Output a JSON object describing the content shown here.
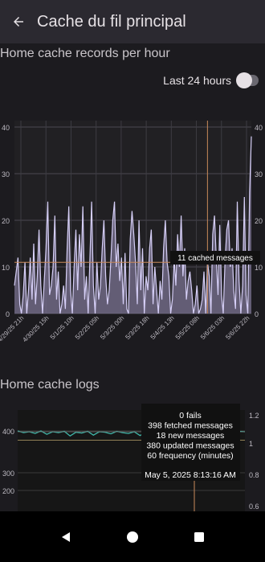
{
  "appbar": {
    "title": "Cache du fil principal"
  },
  "records": {
    "heading": "Home cache records per hour",
    "toggle_label": "Last 24 hours",
    "toggle_on": false,
    "tooltip": "11 cached messages"
  },
  "logs": {
    "heading": "Home cache logs",
    "tooltip_lines": [
      "0 fails",
      "398 fetched messages",
      "18 new messages",
      "380 updated messages",
      "60 frequency (minutes)"
    ],
    "tooltip_date": "May 5, 2025 8:13:16 AM"
  },
  "chart_data": [
    {
      "type": "area",
      "ylim": [
        0,
        40
      ],
      "y_ticks": [
        0,
        10,
        20,
        30,
        40
      ],
      "x_tick_labels": [
        "4/29/25 21h",
        "4/30/25 15h",
        "5/1/25 10h",
        "5/2/25 05h",
        "5/3/25 00h",
        "5/3/25 18h",
        "5/4/25 13h",
        "5/5/25 08h",
        "5/6/25 03h",
        "5/6/25 22h"
      ],
      "highlight_index": 110,
      "highlight_value": 11,
      "values": [
        6,
        9,
        12,
        2,
        0,
        4,
        11,
        0,
        5,
        12,
        3,
        15,
        2,
        8,
        18,
        6,
        0,
        7,
        14,
        24,
        4,
        6,
        10,
        21,
        3,
        9,
        0,
        2,
        6,
        1,
        14,
        23,
        5,
        0,
        10,
        18,
        5,
        17,
        10,
        23,
        3,
        8,
        0,
        12,
        24,
        6,
        0,
        11,
        3,
        6,
        14,
        20,
        8,
        2,
        5,
        12,
        20,
        24,
        10,
        15,
        7,
        12,
        2,
        13,
        1,
        0,
        16,
        22,
        17,
        11,
        2,
        20,
        5,
        14,
        0,
        8,
        5,
        14,
        18,
        2,
        10,
        5,
        0,
        7,
        3,
        14,
        20,
        11,
        8,
        0,
        3,
        12,
        6,
        17,
        10,
        21,
        8,
        14,
        3,
        7,
        9,
        5,
        0,
        2,
        6,
        0,
        1,
        3,
        9,
        0,
        11,
        8,
        0,
        17,
        21,
        12,
        4,
        19,
        4,
        0,
        11,
        18,
        20,
        10,
        14,
        5,
        1,
        24,
        7,
        0,
        6,
        25,
        4,
        0,
        26,
        38
      ]
    },
    {
      "type": "line",
      "y_ticks_left": [
        200,
        300,
        400
      ],
      "y_ticks_right": [
        0.6,
        0.8,
        1.0,
        1.2
      ],
      "series": [
        {
          "values": [
            400,
            396,
            398,
            394,
            400,
            392,
            398,
            396,
            399,
            388,
            397,
            395,
            399,
            390,
            398,
            397,
            393,
            399,
            396,
            394,
            398,
            389,
            397,
            396,
            400,
            393,
            398,
            395,
            397,
            391,
            399,
            396,
            398,
            394,
            400,
            396,
            397,
            392,
            399,
            398
          ]
        },
        {
          "values": [
            378,
            378,
            378,
            378,
            378,
            378,
            378,
            378,
            378,
            378,
            378,
            378,
            378,
            378,
            378,
            378,
            378,
            378,
            378,
            378,
            378,
            378,
            378,
            378,
            378,
            378,
            378,
            378,
            378,
            378,
            378,
            378,
            378,
            378,
            378,
            378,
            378,
            378,
            378,
            378
          ]
        },
        {
          "values": [
            398,
            398,
            398,
            398,
            398,
            398,
            398,
            398,
            398,
            398,
            398,
            398,
            398,
            398,
            398,
            398,
            398,
            398,
            398,
            398,
            398,
            398,
            398,
            398,
            398,
            398,
            398,
            398,
            398,
            398,
            398,
            398,
            398,
            398,
            398,
            398,
            398,
            398,
            398,
            398
          ]
        }
      ]
    }
  ],
  "colors": {
    "area_fill": "#7a7191",
    "area_line": "#d6cff7",
    "marker": "#c98a5a",
    "logs_line": "#3fb6a8",
    "logs_line2": "#b8a36a"
  }
}
